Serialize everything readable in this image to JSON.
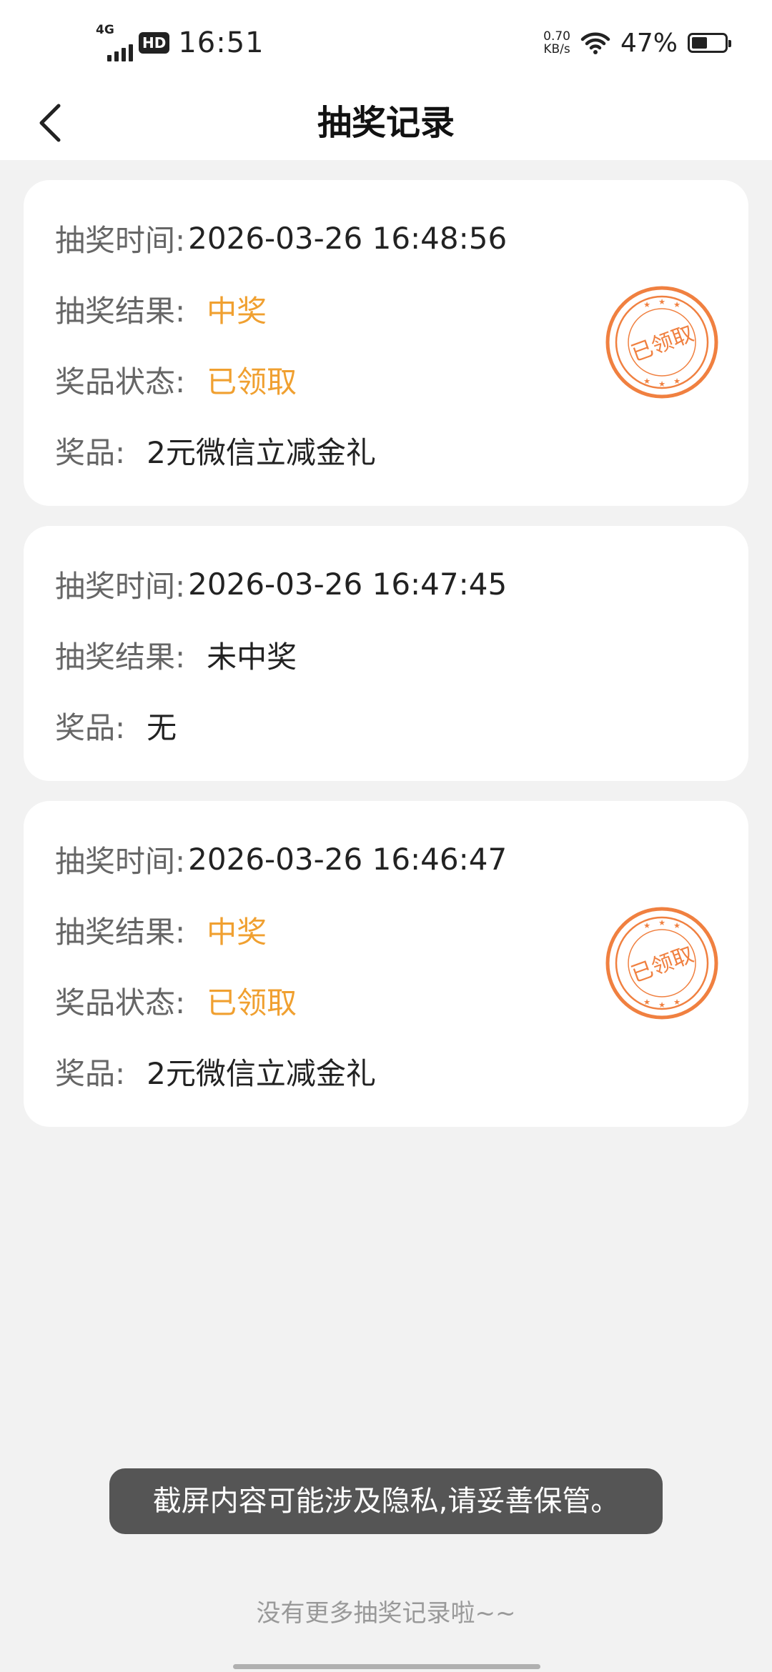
{
  "status_bar": {
    "network_type": "4G",
    "hd_badge": "HD",
    "time": "16:51",
    "net_speed_value": "0.70",
    "net_speed_unit": "KB/s",
    "battery_percent": "47%",
    "battery_level": 0.47
  },
  "header": {
    "title": "抽奖记录",
    "back_icon": "chevron-left-icon"
  },
  "labels": {
    "time": "抽奖时间:",
    "result": "抽奖结果:",
    "status": "奖品状态:",
    "prize": "奖品:"
  },
  "records": [
    {
      "time": "2026-03-26 16:48:56",
      "result": "中奖",
      "status": "已领取",
      "prize": "2元微信立减金礼",
      "stamp_text": "已领取"
    },
    {
      "time": "2026-03-26 16:47:45",
      "result": "未中奖",
      "prize": "无"
    },
    {
      "time": "2026-03-26 16:46:47",
      "result": "中奖",
      "status": "已领取",
      "prize": "2元微信立减金礼",
      "stamp_text": "已领取"
    }
  ],
  "toast": {
    "message": "截屏内容可能涉及隐私,请妥善保管。"
  },
  "footer": {
    "no_more": "没有更多抽奖记录啦~~"
  },
  "colors": {
    "highlight": "#f0a030",
    "stamp": "#f08040",
    "background": "#f2f2f2",
    "card": "#ffffff"
  }
}
